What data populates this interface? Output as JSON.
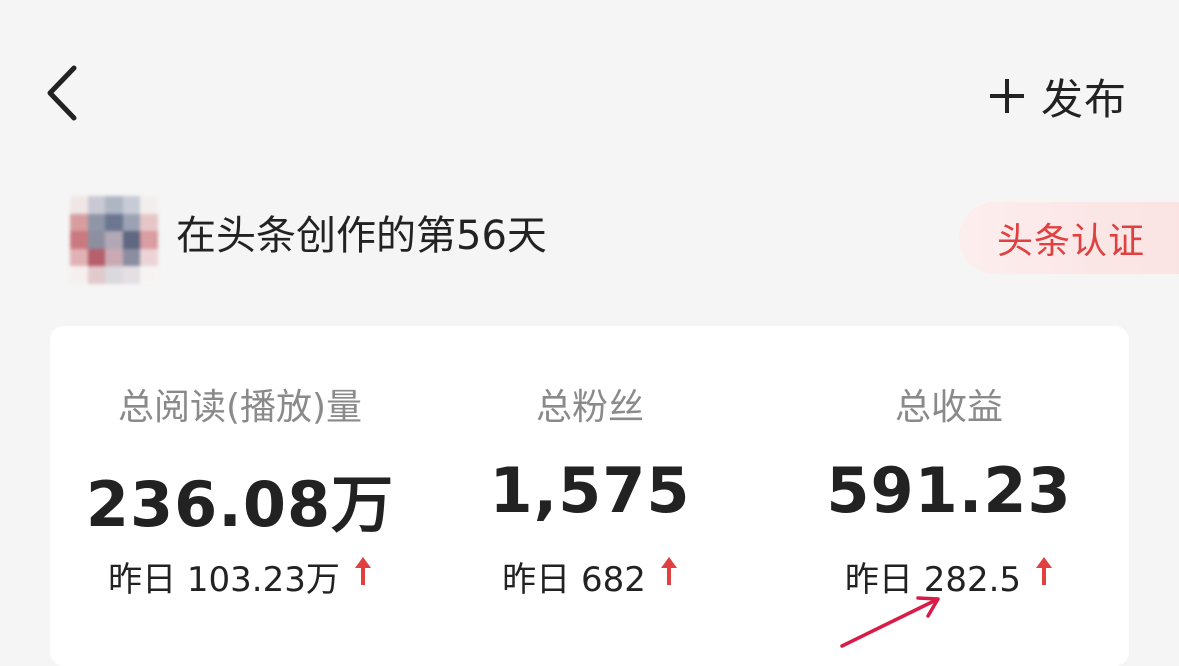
{
  "header": {
    "back_icon": "chevron-left-icon",
    "publish_icon": "plus-icon",
    "publish_label": "发布"
  },
  "profile": {
    "avatar_icon": "avatar-blurred",
    "creation_text": "在头条创作的第56天",
    "cert_label": "头条认证"
  },
  "stats": [
    {
      "label": "总阅读(播放)量",
      "value": "236.08万",
      "yesterday": "昨日 103.23万",
      "trend_icon": "up-arrow-icon"
    },
    {
      "label": "总粉丝",
      "value": "1,575",
      "yesterday": "昨日 682",
      "trend_icon": "up-arrow-icon"
    },
    {
      "label": "总收益",
      "value": "591.23",
      "yesterday": "昨日 282.5",
      "trend_icon": "up-arrow-icon"
    }
  ],
  "colors": {
    "accent_red": "#e0403f",
    "annotation_red": "#d81b47",
    "background": "#f5f5f5",
    "card": "#ffffff"
  }
}
